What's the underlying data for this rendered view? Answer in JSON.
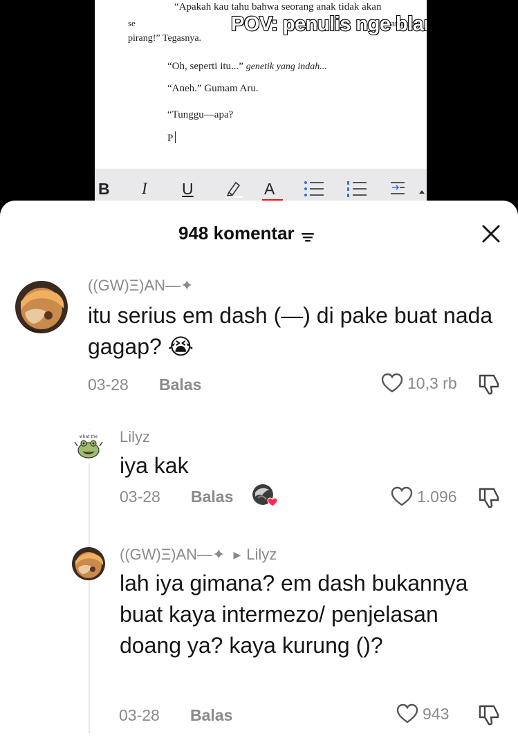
{
  "video": {
    "doc_lines": {
      "line1": "“Apakah kau tahu bahwa seorang anak tidak akan",
      "line2_start": "se",
      "line2_end": "rambut",
      "line3": "pirang!” Tegasnya.",
      "line4_start": "“Oh, seperti itu...”",
      "line4_italic": "genetik yang indah...",
      "line5": "“Aneh.” Gumam Aru.",
      "line6": "“Tunggu—apa?",
      "line7": "P"
    },
    "caption": "POV: penulis nge blank",
    "toolbar": {
      "bold": "B",
      "italic": "I",
      "underline": "U",
      "color": "A",
      "color_bar": "#e11111"
    }
  },
  "sheet": {
    "title": "948 komentar",
    "sort_icon": "sort-icon",
    "close_icon": "close-icon"
  },
  "comments": [
    {
      "username": "((GW)Ξ)AN—✦",
      "text": "itu serius em dash (—) di pake buat nada gagap? 😭",
      "date": "03-28",
      "reply_label": "Balas",
      "likes": "10,3 rb"
    },
    {
      "username": "Lilyz",
      "avatar_text": "what the",
      "text": "iya kak",
      "date": "03-28",
      "reply_label": "Balas",
      "likes": "1.096"
    },
    {
      "username": "((GW)Ξ)AN—✦",
      "reply_to": "Lilyz",
      "text": "lah iya gimana? em dash bukannya buat kaya intermezo/ penjelasan doang ya? kaya kurung ()?",
      "date": "03-28",
      "reply_label": "Balas",
      "likes": "943"
    }
  ],
  "colors": {
    "sheet_bg": "#ffffff",
    "muted_text": "#8a8a8a",
    "body_text": "#161616",
    "creator_like_heart": "#fe2c55"
  }
}
